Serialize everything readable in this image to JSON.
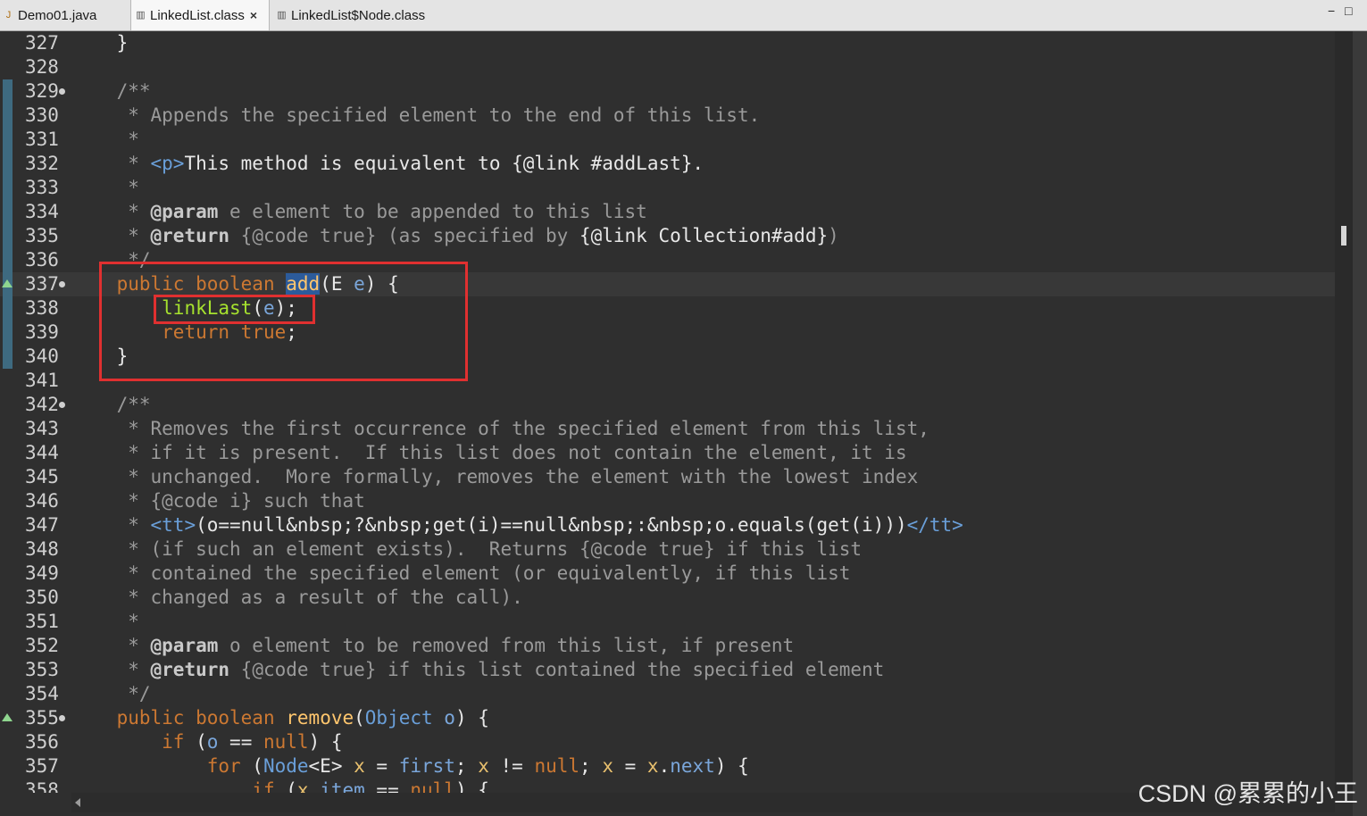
{
  "tabs": [
    {
      "label": "Demo01.java",
      "icon": "java-file-icon"
    },
    {
      "label": "LinkedList.class",
      "icon": "class-file-icon",
      "close": "×"
    },
    {
      "label": "LinkedList$Node.class",
      "icon": "class-file-icon"
    }
  ],
  "window_controls": {
    "minimize": "−",
    "maximize": "□"
  },
  "watermark": "CSDN @累累的小王",
  "line_numbers": [
    "327",
    "328",
    "329",
    "330",
    "331",
    "332",
    "333",
    "334",
    "335",
    "336",
    "337",
    "338",
    "339",
    "340",
    "341",
    "342",
    "343",
    "344",
    "345",
    "346",
    "347",
    "348",
    "349",
    "350",
    "351",
    "352",
    "353",
    "354",
    "355",
    "356",
    "357",
    "358"
  ],
  "code": {
    "l327": "}",
    "l329": "/**",
    "l330": " * Appends the specified element to the end of this list.",
    "l331": " *",
    "l332_a": " * ",
    "l332_tag": "<p>",
    "l332_b": "This method is equivalent to {@link #addLast}.",
    "l333": " *",
    "l334_a": " * ",
    "l334_tag": "@param",
    "l334_b": " e element to be appended to this list",
    "l335_a": " * ",
    "l335_tag": "@return",
    "l335_b": " {@code true} (as specified by ",
    "l335_c": "{@link Collection#add}",
    "l335_d": ")",
    "l336": " */",
    "l337_public": "public",
    "l337_boolean": "boolean",
    "l337_add": "add",
    "l337_open": "(E ",
    "l337_e": "e",
    "l337_close": ") {",
    "l338_call": "linkLast",
    "l338_open": "(",
    "l338_e": "e",
    "l338_close": ");",
    "l339_return": "return",
    "l339_true": "true",
    "l339_semi": ";",
    "l340": "}",
    "l342": "/**",
    "l343": " * Removes the first occurrence of the specified element from this list,",
    "l344": " * if it is present.  If this list does not contain the element, it is",
    "l345": " * unchanged.  More formally, removes the element with the lowest index",
    "l346": " * {@code i} such that",
    "l347_a": " * ",
    "l347_tt": "<tt>",
    "l347_b": "(o==null&nbsp;?&nbsp;get(i)==null&nbsp;:&nbsp;o.equals(get(i)))",
    "l347_tt2": "</tt>",
    "l348": " * (if such an element exists).  Returns {@code true} if this list",
    "l349": " * contained the specified element (or equivalently, if this list",
    "l350": " * changed as a result of the call).",
    "l351": " *",
    "l352_a": " * ",
    "l352_tag": "@param",
    "l352_b": " o element to be removed from this list, if present",
    "l353_a": " * ",
    "l353_tag": "@return",
    "l353_b": " {@code true} if this list contained the specified element",
    "l354": " */",
    "l355_public": "public",
    "l355_boolean": "boolean",
    "l355_remove": "remove",
    "l355_open": "(",
    "l355_type": "Object",
    "l355_o": "o",
    "l355_close": ") {",
    "l356_if": "if",
    "l356_open": " (",
    "l356_o": "o",
    "l356_eq": " == ",
    "l356_null": "null",
    "l356_close": ") {",
    "l357_for": "for",
    "l357_open": " (",
    "l357_node": "Node",
    "l357_gen": "<E> ",
    "l357_x": "x",
    "l357_eq": " = ",
    "l357_first": "first",
    "l357_semi1": "; ",
    "l357_x2": "x",
    "l357_ne": " != ",
    "l357_null": "null",
    "l357_semi2": "; ",
    "l357_x3": "x",
    "l357_eq2": " = ",
    "l357_x4": "x",
    "l357_dot": ".",
    "l357_next": "next",
    "l357_close": ") {",
    "l358_if": "if",
    "l358_open": " (",
    "l358_x": "x",
    "l358_dot": ".",
    "l358_item": "item",
    "l358_eq": " == ",
    "l358_null": "null",
    "l358_close": ") {"
  }
}
